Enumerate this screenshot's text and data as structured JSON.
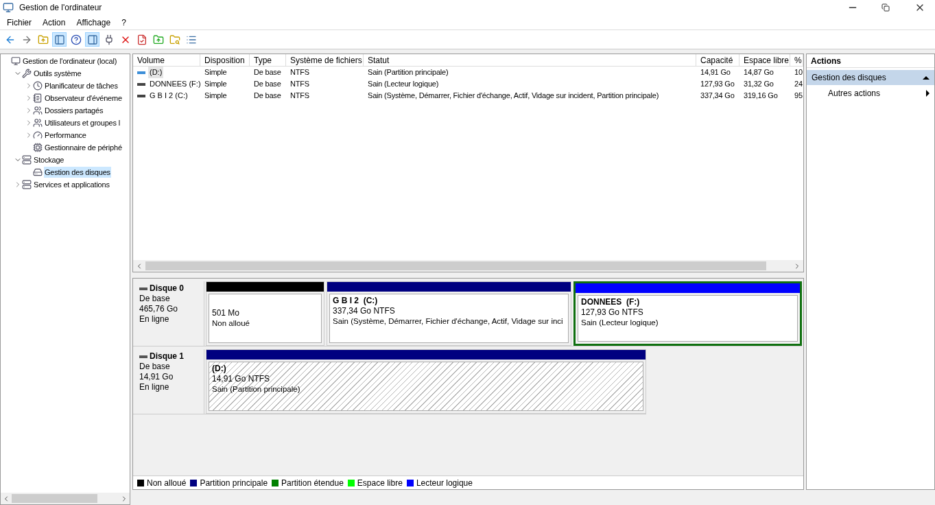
{
  "window": {
    "title": "Gestion de l'ordinateur"
  },
  "menu": [
    "Fichier",
    "Action",
    "Affichage",
    "?"
  ],
  "toolbar": [
    {
      "pressed": false
    },
    {
      "pressed": false
    },
    {
      "pressed": false
    },
    {
      "pressed": true
    },
    {
      "pressed": false
    },
    {
      "pressed": true
    },
    {
      "pressed": false
    },
    {
      "pressed": false
    },
    {
      "pressed": false
    },
    {
      "pressed": false
    },
    {
      "pressed": false
    },
    {
      "pressed": false
    }
  ],
  "tree": [
    {
      "label": "Gestion de l'ordinateur (local)",
      "selected": false,
      "children": [
        {
          "label": "Outils système",
          "expanded": true,
          "selected": false,
          "children": [
            {
              "label": "Planificateur de tâches",
              "expanded": false,
              "selected": false
            },
            {
              "label": "Observateur d'événeme",
              "expanded": false,
              "selected": false
            },
            {
              "label": "Dossiers partagés",
              "expanded": false,
              "selected": false
            },
            {
              "label": "Utilisateurs et groupes l",
              "expanded": false,
              "selected": false
            },
            {
              "label": "Performance",
              "expanded": false,
              "selected": false
            },
            {
              "label": "Gestionnaire de périphé",
              "selected": false
            }
          ]
        },
        {
          "label": "Stockage",
          "expanded": true,
          "selected": false,
          "children": [
            {
              "label": "Gestion des disques",
              "selected": true
            }
          ]
        },
        {
          "label": "Services et applications",
          "expanded": false,
          "selected": false
        }
      ]
    }
  ],
  "volumes": {
    "columns": [
      "Volume",
      "Disposition",
      "Type",
      "Système de fichiers",
      "Statut",
      "Capacité",
      "Espace libre",
      "%"
    ],
    "rows": [
      {
        "kind": "removable",
        "selected": true,
        "cells": [
          "(D:)",
          "Simple",
          "De base",
          "NTFS",
          "Sain (Partition principale)",
          "14,91 Go",
          "14,87 Go",
          "10"
        ]
      },
      {
        "kind": "fixed",
        "selected": false,
        "cells": [
          "DONNEES (F:)",
          "Simple",
          "De base",
          "NTFS",
          "Sain (Lecteur logique)",
          "127,93 Go",
          "31,32 Go",
          "24"
        ]
      },
      {
        "kind": "fixed",
        "selected": false,
        "cells": [
          "G B I 2 (C:)",
          "Simple",
          "De base",
          "NTFS",
          "Sain (Système, Démarrer, Fichier d'échange, Actif, Vidage sur incident, Partition principale)",
          "337,34 Go",
          "319,16 Go",
          "95"
        ]
      }
    ]
  },
  "disks": [
    {
      "name": "Disque 0",
      "type": "De base",
      "size": "465,76 Go",
      "state": "En ligne",
      "partitions": [
        {
          "color": "#000000",
          "selected": false,
          "in_extended": false,
          "size": "501 Mo",
          "status": "Non alloué"
        },
        {
          "color": "#000080",
          "selected": false,
          "in_extended": false,
          "name": "G B I 2  (C:)",
          "size": "337,34 Go NTFS",
          "status": "Sain (Système, Démarrer, Fichier d'échange, Actif, Vidage sur inci"
        },
        {
          "color": "#0000ff",
          "selected": false,
          "in_extended": true,
          "name": "DONNEES  (F:)",
          "size": "127,93 Go NTFS",
          "status": "Sain (Lecteur logique)"
        }
      ]
    },
    {
      "name": "Disque 1",
      "type": "De base",
      "size": "14,91 Go",
      "state": "En ligne",
      "partitions": [
        {
          "color": "#000080",
          "selected": true,
          "in_extended": false,
          "name": "(D:)",
          "size": "14,91 Go NTFS",
          "status": "Sain (Partition principale)"
        }
      ]
    }
  ],
  "legend": [
    {
      "label": "Non alloué",
      "color": "#000000"
    },
    {
      "label": "Partition principale",
      "color": "#000080"
    },
    {
      "label": "Partition étendue",
      "color": "#008000"
    },
    {
      "label": "Espace libre",
      "color": "#00ff00"
    },
    {
      "label": "Lecteur logique",
      "color": "#0000ff"
    }
  ],
  "actions": {
    "title": "Actions",
    "sections": [
      {
        "label": "Gestion des disques",
        "expanded": true,
        "items": [
          "Autres actions"
        ]
      }
    ]
  }
}
